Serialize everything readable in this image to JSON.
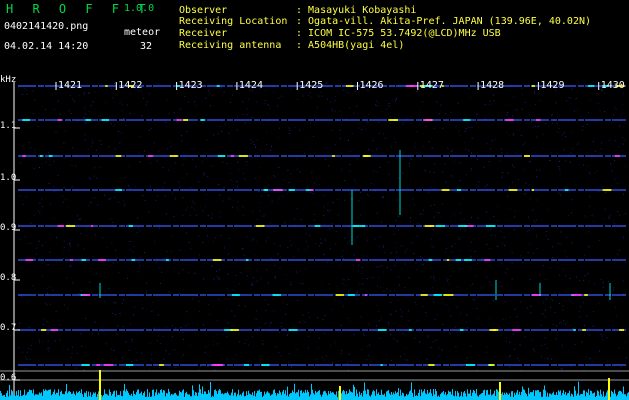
{
  "header": {
    "logo_text": "H R O F F T",
    "version": "1.0.0",
    "file_name": "0402141420.png",
    "meteor_label": "meteor",
    "meteor_count": "32",
    "datetime": "04.02.14 14:20"
  },
  "info": [
    {
      "label": "Observer",
      "value": ": Masayuki Kobayashi"
    },
    {
      "label": "Receiving Location",
      "value": ": Ogata-vill. Akita-Pref. JAPAN (139.96E, 40.02N)"
    },
    {
      "label": "Receiver",
      "value": ": ICOM IC-575 53.7492(@LCD)MHz USB"
    },
    {
      "label": "Receiving antenna",
      "value": ": A504HB(yagi 4el)"
    }
  ],
  "chart_data": {
    "type": "heatmap",
    "y_unit": "kHz",
    "y_ticks": [
      "1.1",
      "1.0",
      "0.9",
      "0.8",
      "0.7",
      "0.6"
    ],
    "ylim": [
      0.6,
      1.15
    ],
    "x_ticks": [
      "1421",
      "1422",
      "1423",
      "1424",
      "1425",
      "1426",
      "1427",
      "1428",
      "1429",
      "1430"
    ],
    "colors": {
      "background": "#000000",
      "noise": "#1a2a9a",
      "signal_cyan": "#00ffff",
      "signal_yellow": "#ffff00",
      "signal_magenta": "#ff3cff",
      "histogram": "#00c8ff",
      "text_green": "#00d84a",
      "text_yellow": "#ffff44"
    }
  }
}
